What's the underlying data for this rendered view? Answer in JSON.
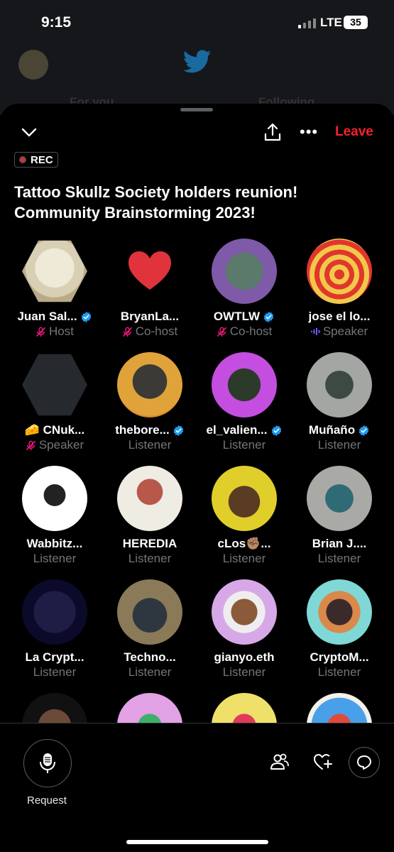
{
  "status_bar": {
    "time": "9:15",
    "network": "LTE",
    "battery": "35"
  },
  "background": {
    "tab_left": "For you",
    "tab_right": "Following"
  },
  "space": {
    "rec_label": "REC",
    "title": "Tattoo Skullz Society holders reunion! Community Brainstorming  2023!",
    "leave_label": "Leave",
    "accent_color": "#f4212e",
    "verified_color": "#1d9bf0"
  },
  "participants": [
    {
      "name": "Juan Sal...",
      "role": "Host",
      "verified": true,
      "role_icon": "mic-off-icon"
    },
    {
      "name": "BryanLa...",
      "role": "Co-host",
      "verified": false,
      "role_icon": "mic-off-icon"
    },
    {
      "name": "OWTLW",
      "role": "Co-host",
      "verified": true,
      "role_icon": "mic-off-icon"
    },
    {
      "name": "jose el lo...",
      "role": "Speaker",
      "verified": false,
      "role_icon": "speaking-icon"
    },
    {
      "name": "🧀 CNuk...",
      "role": "Speaker",
      "verified": false,
      "role_icon": "mic-off-icon"
    },
    {
      "name": "thebore...",
      "role": "Listener",
      "verified": true,
      "role_icon": ""
    },
    {
      "name": "el_valien...",
      "role": "Listener",
      "verified": true,
      "role_icon": ""
    },
    {
      "name": "Muñaño",
      "role": "Listener",
      "verified": true,
      "role_icon": ""
    },
    {
      "name": "Wabbitz...",
      "role": "Listener",
      "verified": false,
      "role_icon": ""
    },
    {
      "name": "HEREDIA",
      "role": "Listener",
      "verified": false,
      "role_icon": ""
    },
    {
      "name": "cLos✊🏽...",
      "role": "Listener",
      "verified": false,
      "role_icon": ""
    },
    {
      "name": "Brian J....",
      "role": "Listener",
      "verified": false,
      "role_icon": ""
    },
    {
      "name": "La Crypt...",
      "role": "Listener",
      "verified": false,
      "role_icon": ""
    },
    {
      "name": "Techno...",
      "role": "Listener",
      "verified": false,
      "role_icon": ""
    },
    {
      "name": "gianyo.eth",
      "role": "Listener",
      "verified": false,
      "role_icon": ""
    },
    {
      "name": "CryptoM...",
      "role": "Listener",
      "verified": false,
      "role_icon": ""
    },
    {
      "name": "",
      "role": "",
      "verified": false,
      "role_icon": ""
    },
    {
      "name": "",
      "role": "",
      "verified": false,
      "role_icon": ""
    },
    {
      "name": "",
      "role": "",
      "verified": false,
      "role_icon": ""
    },
    {
      "name": "",
      "role": "",
      "verified": false,
      "role_icon": ""
    }
  ],
  "bottom": {
    "request_label": "Request"
  }
}
